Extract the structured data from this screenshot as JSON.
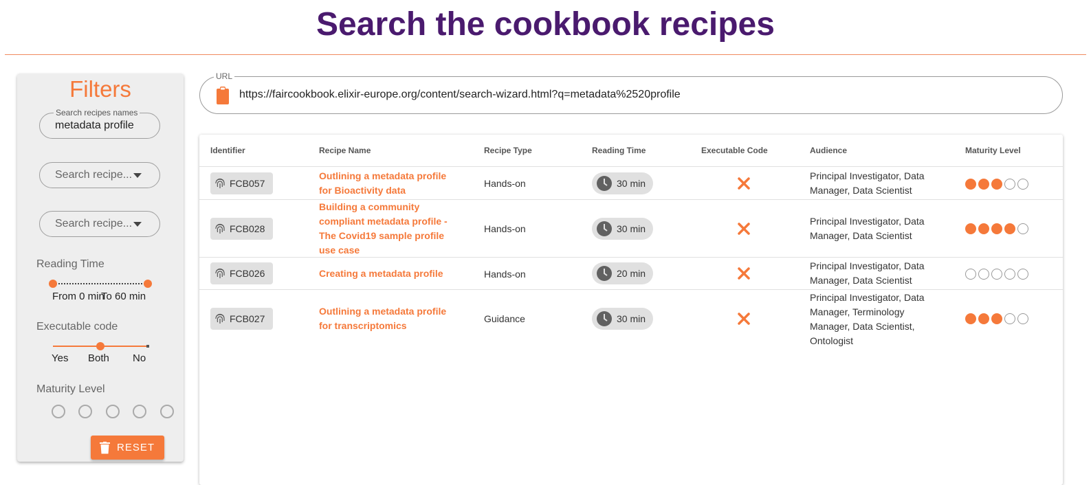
{
  "header": {
    "title": "Search the cookbook recipes"
  },
  "filters": {
    "title": "Filters",
    "search": {
      "legend": "Search recipes names",
      "value": "metadata profile"
    },
    "dropdown1": {
      "placeholder": "Search recipe..."
    },
    "dropdown2": {
      "placeholder": "Search recipe..."
    },
    "reading_time": {
      "label": "Reading Time",
      "from_label": "From 0 min",
      "to_label": "To 60 min",
      "from": 0,
      "to": 60
    },
    "executable_code": {
      "label": "Executable code",
      "options": [
        "Yes",
        "Both",
        "No"
      ],
      "selected": "Both"
    },
    "maturity": {
      "label": "Maturity Level",
      "count": 5
    },
    "reset_label": "RESET"
  },
  "url_bar": {
    "legend": "URL",
    "value": "https://faircookbook.elixir-europe.org/content/search-wizard.html?q=metadata%2520profile",
    "icon": "clipboard-icon"
  },
  "table": {
    "headers": [
      "Identifier",
      "Recipe Name",
      "Recipe Type",
      "Reading Time",
      "Executable Code",
      "Audience",
      "Maturity Level"
    ],
    "rows": [
      {
        "id": "FCB057",
        "name": "Outlining a metadata profile for Bioactivity data",
        "type": "Hands-on",
        "time": "30 min",
        "executable": false,
        "audience": "Principal Investigator, Data Manager, Data Scientist",
        "maturity": 3
      },
      {
        "id": "FCB028",
        "name": "Building a community compliant metadata profile - The Covid19 sample profile use case",
        "type": "Hands-on",
        "time": "30 min",
        "executable": false,
        "audience": "Principal Investigator, Data Manager, Data Scientist",
        "maturity": 4
      },
      {
        "id": "FCB026",
        "name": "Creating a metadata profile",
        "type": "Hands-on",
        "time": "20 min",
        "executable": false,
        "audience": "Principal Investigator, Data Manager, Data Scientist",
        "maturity": 0
      },
      {
        "id": "FCB027",
        "name": "Outlining a metadata profile for transcriptomics",
        "type": "Guidance",
        "time": "30 min",
        "executable": false,
        "audience": "Principal Investigator, Data Manager, Terminology Manager, Data Scientist, Ontologist",
        "maturity": 3
      }
    ]
  },
  "colors": {
    "accent": "#f5793a",
    "title": "#4a1a6e",
    "chip": "#e0e0e0"
  }
}
